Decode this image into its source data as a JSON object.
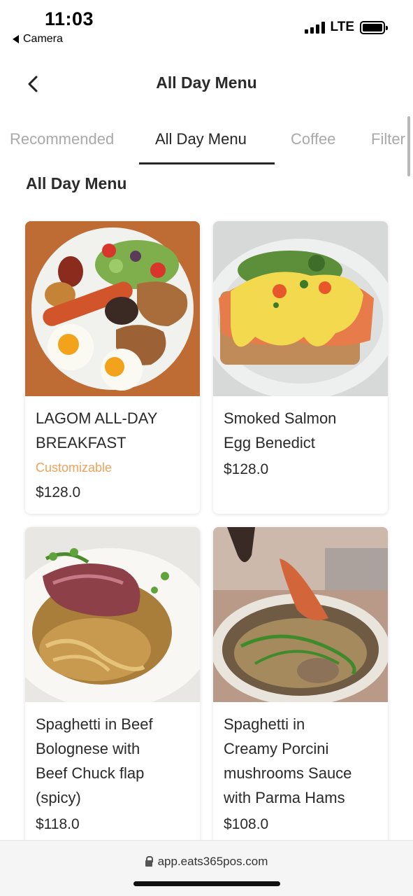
{
  "status_bar": {
    "time": "11:03",
    "back_app": "Camera",
    "network": "LTE"
  },
  "header": {
    "title": "All Day Menu",
    "back_icon": "chevron-left-icon"
  },
  "tabs": [
    {
      "label": "Recommended",
      "active": false
    },
    {
      "label": "All Day Menu",
      "active": true
    },
    {
      "label": "Coffee",
      "active": false
    },
    {
      "label": "Filter",
      "active": false
    }
  ],
  "section": {
    "title": "All Day Menu"
  },
  "items": [
    {
      "name_line1": "LAGOM ALL-DAY",
      "name_line2": "BREAKFAST",
      "tag": "Customizable",
      "price": "$128.0"
    },
    {
      "name_line1": "Smoked Salmon",
      "name_line2": "Egg Benedict",
      "price": "$128.0"
    },
    {
      "name_line1": "Spaghetti in Beef",
      "name_line2": "Bolognese with",
      "name_line3": "Beef Chuck flap",
      "name_line4": "(spicy)",
      "price": "$118.0"
    },
    {
      "name_line1": "Spaghetti in",
      "name_line2": "Creamy Porcini",
      "name_line3": "mushrooms Sauce",
      "name_line4": "with Parma Hams",
      "price": "$108.0"
    }
  ],
  "browser": {
    "url": "app.eats365pos.com"
  },
  "colors": {
    "accent_tag": "#f0a25c",
    "text": "#2a2a2a",
    "inactive_tab": "#a9a9a9"
  }
}
